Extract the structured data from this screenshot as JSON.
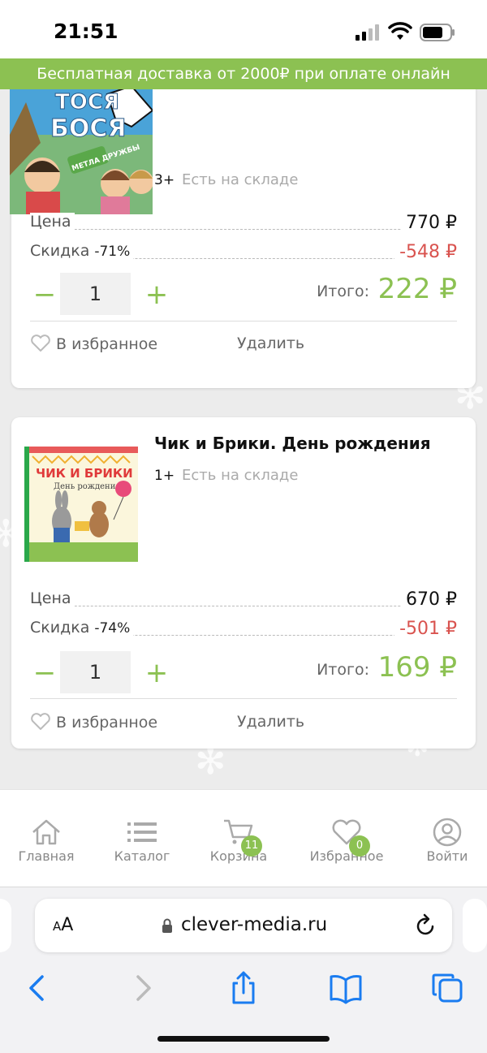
{
  "status_bar": {
    "time": "21:51"
  },
  "promo_banner": "Бесплатная доставка от 2000₽ при оплате онлайн",
  "cart_items": [
    {
      "title": "",
      "cover_text": {
        "line1": "ТОСЯ",
        "line2": "БОСЯ",
        "badge": "МЕТЛА ДРУЖБЫ"
      },
      "age": "3+",
      "stock": "Есть на складе",
      "price_label": "Цена",
      "price": "770 ₽",
      "discount_label": "Скидка",
      "discount_percent": "-71%",
      "discount_value": "-548 ₽",
      "quantity": "1",
      "minus": "−",
      "plus": "+",
      "total_label": "Итого:",
      "total": "222 ₽",
      "favorite_label": "В избранное",
      "delete_label": "Удалить"
    },
    {
      "title": "Чик и Брики. День рождения",
      "cover_text": {
        "line1": "ЧИК И БРИКИ",
        "line2": "День рождения"
      },
      "age": "1+",
      "stock": "Есть на складе",
      "price_label": "Цена",
      "price": "670 ₽",
      "discount_label": "Скидка",
      "discount_percent": "-74%",
      "discount_value": "-501 ₽",
      "quantity": "1",
      "minus": "−",
      "plus": "+",
      "total_label": "Итого:",
      "total": "169 ₽",
      "favorite_label": "В избранное",
      "delete_label": "Удалить"
    }
  ],
  "tab_bar": [
    {
      "label": "Главная",
      "icon": "home-icon"
    },
    {
      "label": "Каталог",
      "icon": "list-icon"
    },
    {
      "label": "Корзина",
      "icon": "cart-icon",
      "badge": "11"
    },
    {
      "label": "Избранное",
      "icon": "heart-icon",
      "badge": "0"
    },
    {
      "label": "Войти",
      "icon": "user-icon"
    }
  ],
  "browser": {
    "text_size": "AA",
    "url": "clever-media.ru"
  },
  "colors": {
    "accent": "#8cc152",
    "discount": "#d9534f"
  }
}
